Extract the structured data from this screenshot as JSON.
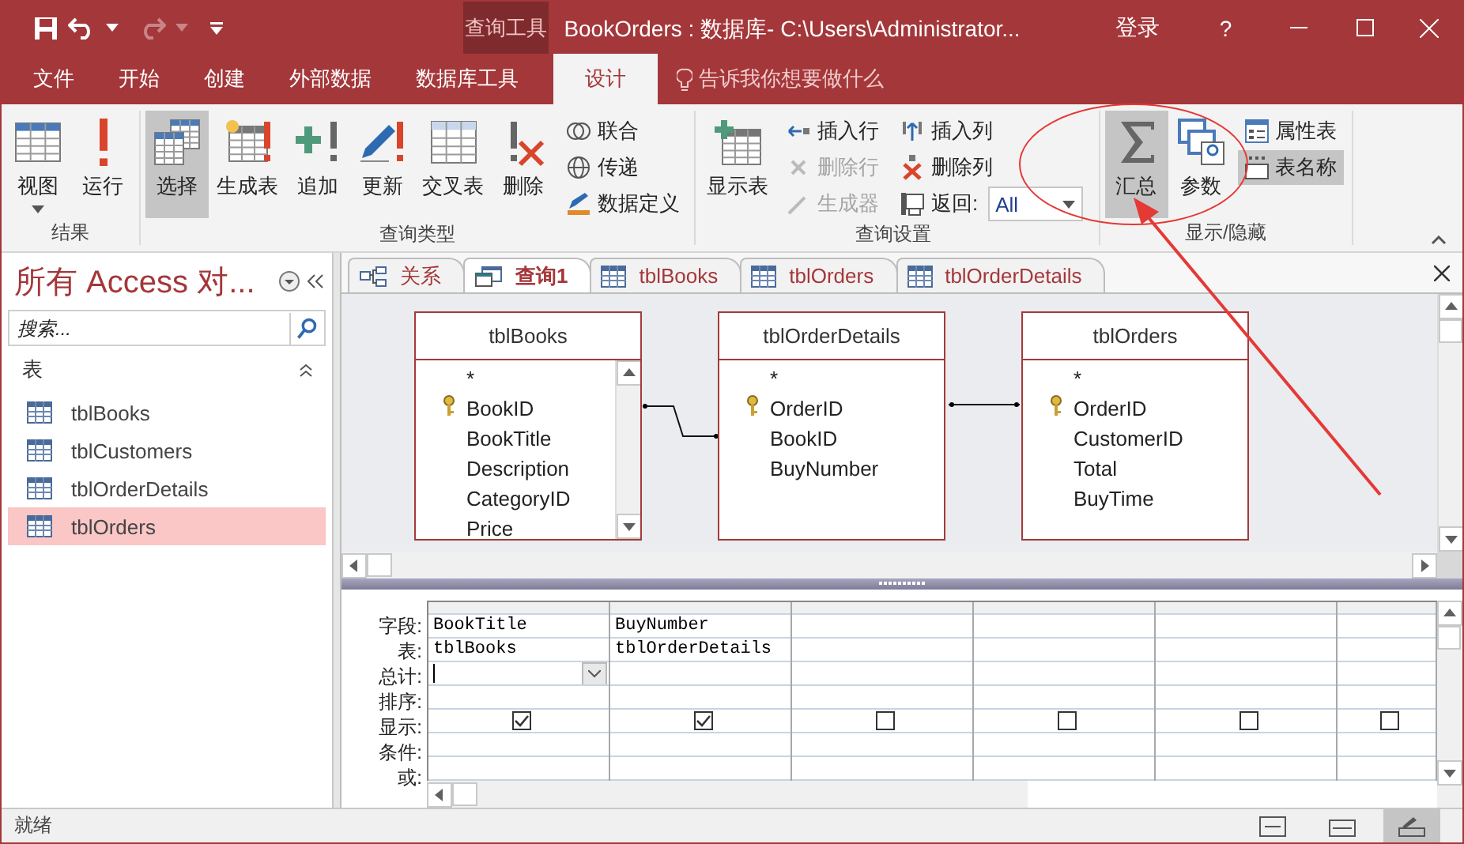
{
  "title_bar": {
    "contextual_tab": "查询工具",
    "title": "BookOrders : 数据库- C:\\Users\\Administrator...",
    "sign_in": "登录",
    "help": "?"
  },
  "ribbon_tabs": [
    {
      "label": "文件",
      "selected": false
    },
    {
      "label": "开始",
      "selected": false
    },
    {
      "label": "创建",
      "selected": false
    },
    {
      "label": "外部数据",
      "selected": false
    },
    {
      "label": "数据库工具",
      "selected": false
    },
    {
      "label": "设计",
      "selected": true
    }
  ],
  "tell_me": {
    "placeholder": "告诉我你想要做什么"
  },
  "ribbon_groups": [
    {
      "label": "结果",
      "items": [
        {
          "kind": "large",
          "label": "视图",
          "selected": false,
          "disabled": false,
          "dropdown": true
        },
        {
          "kind": "large",
          "label": "运行",
          "selected": false,
          "disabled": false,
          "dropdown": false
        }
      ]
    },
    {
      "label": "查询类型",
      "items": [
        {
          "kind": "large",
          "label": "选择",
          "selected": true,
          "disabled": false,
          "dropdown": false
        },
        {
          "kind": "large",
          "label": "生成表",
          "selected": false,
          "disabled": false,
          "dropdown": false
        },
        {
          "kind": "large",
          "label": "追加",
          "selected": false,
          "disabled": false,
          "dropdown": false
        },
        {
          "kind": "large",
          "label": "更新",
          "selected": false,
          "disabled": false,
          "dropdown": false
        },
        {
          "kind": "large",
          "label": "交叉表",
          "selected": false,
          "disabled": false,
          "dropdown": false
        },
        {
          "kind": "large",
          "label": "删除",
          "selected": false,
          "disabled": false,
          "dropdown": false
        },
        {
          "kind": "stack",
          "buttons": [
            {
              "kind": "small",
              "label": "联合",
              "selected": false,
              "disabled": false
            },
            {
              "kind": "small",
              "label": "传递",
              "selected": false,
              "disabled": false
            },
            {
              "kind": "small",
              "label": "数据定义",
              "selected": false,
              "disabled": false
            }
          ]
        }
      ]
    },
    {
      "label": "查询设置",
      "items": [
        {
          "kind": "large",
          "label": "显示表",
          "selected": false,
          "disabled": false,
          "dropdown": false
        },
        {
          "kind": "stack",
          "buttons": [
            {
              "kind": "small",
              "label": "插入行",
              "selected": false,
              "disabled": false
            },
            {
              "kind": "small",
              "label": "删除行",
              "selected": false,
              "disabled": true
            },
            {
              "kind": "small",
              "label": "生成器",
              "selected": false,
              "disabled": true
            }
          ]
        },
        {
          "kind": "stack",
          "buttons": [
            {
              "kind": "small",
              "label": "插入列",
              "selected": false,
              "disabled": false
            },
            {
              "kind": "small",
              "label": "删除列",
              "selected": false,
              "disabled": false
            },
            {
              "kind": "combo",
              "label": "返回:",
              "value": "All",
              "selected": false,
              "disabled": false
            }
          ]
        }
      ]
    },
    {
      "label": "显示/隐藏",
      "items": [
        {
          "kind": "large",
          "label": "汇总",
          "selected": true,
          "disabled": false,
          "dropdown": false
        },
        {
          "kind": "large",
          "label": "参数",
          "selected": false,
          "disabled": false,
          "dropdown": false
        },
        {
          "kind": "stack",
          "buttons": [
            {
              "kind": "small",
              "label": "属性表",
              "selected": false,
              "disabled": false
            },
            {
              "kind": "small",
              "label": "表名称",
              "selected": true,
              "disabled": false
            }
          ]
        }
      ]
    }
  ],
  "nav_pane": {
    "title": "所有 Access 对...",
    "search": {
      "placeholder": "搜索..."
    },
    "group": "表",
    "items": [
      {
        "label": "tblBooks",
        "selected": false
      },
      {
        "label": "tblCustomers",
        "selected": false
      },
      {
        "label": "tblOrderDetails",
        "selected": false
      },
      {
        "label": "tblOrders",
        "selected": true
      }
    ]
  },
  "document_tabs": [
    {
      "kind": "relationships",
      "label": "关系",
      "selected": false
    },
    {
      "kind": "query",
      "label": "查询1",
      "selected": true
    },
    {
      "kind": "table",
      "label": "tblBooks",
      "selected": false
    },
    {
      "kind": "table",
      "label": "tblOrders",
      "selected": false
    },
    {
      "kind": "table",
      "label": "tblOrderDetails",
      "selected": false
    }
  ],
  "tables": [
    {
      "name": "tblBooks",
      "scrollable": true,
      "fields": [
        {
          "name": "*",
          "key": false
        },
        {
          "name": "BookID",
          "key": true
        },
        {
          "name": "BookTitle",
          "key": false
        },
        {
          "name": "Description",
          "key": false
        },
        {
          "name": "CategoryID",
          "key": false
        },
        {
          "name": "Price",
          "key": false
        }
      ]
    },
    {
      "name": "tblOrderDetails",
      "scrollable": false,
      "fields": [
        {
          "name": "*",
          "key": false
        },
        {
          "name": "OrderID",
          "key": true
        },
        {
          "name": "BookID",
          "key": false
        },
        {
          "name": "BuyNumber",
          "key": false
        }
      ]
    },
    {
      "name": "tblOrders",
      "scrollable": false,
      "fields": [
        {
          "name": "*",
          "key": false
        },
        {
          "name": "OrderID",
          "key": true
        },
        {
          "name": "CustomerID",
          "key": false
        },
        {
          "name": "Total",
          "key": false
        },
        {
          "name": "BuyTime",
          "key": false
        }
      ]
    }
  ],
  "grid": {
    "row_labels": [
      "字段:",
      "表:",
      "总计:",
      "排序:",
      "显示:",
      "条件:",
      "或:"
    ],
    "columns": [
      {
        "field": "BookTitle",
        "table": "tblBooks",
        "show": true,
        "active": true
      },
      {
        "field": "BuyNumber",
        "table": "tblOrderDetails",
        "show": true,
        "active": false
      },
      {
        "show": false,
        "active": false
      },
      {
        "show": false,
        "active": false
      },
      {
        "show": false,
        "active": false
      },
      {
        "show": false,
        "active": false
      }
    ]
  },
  "status_bar": {
    "text": "就绪"
  }
}
